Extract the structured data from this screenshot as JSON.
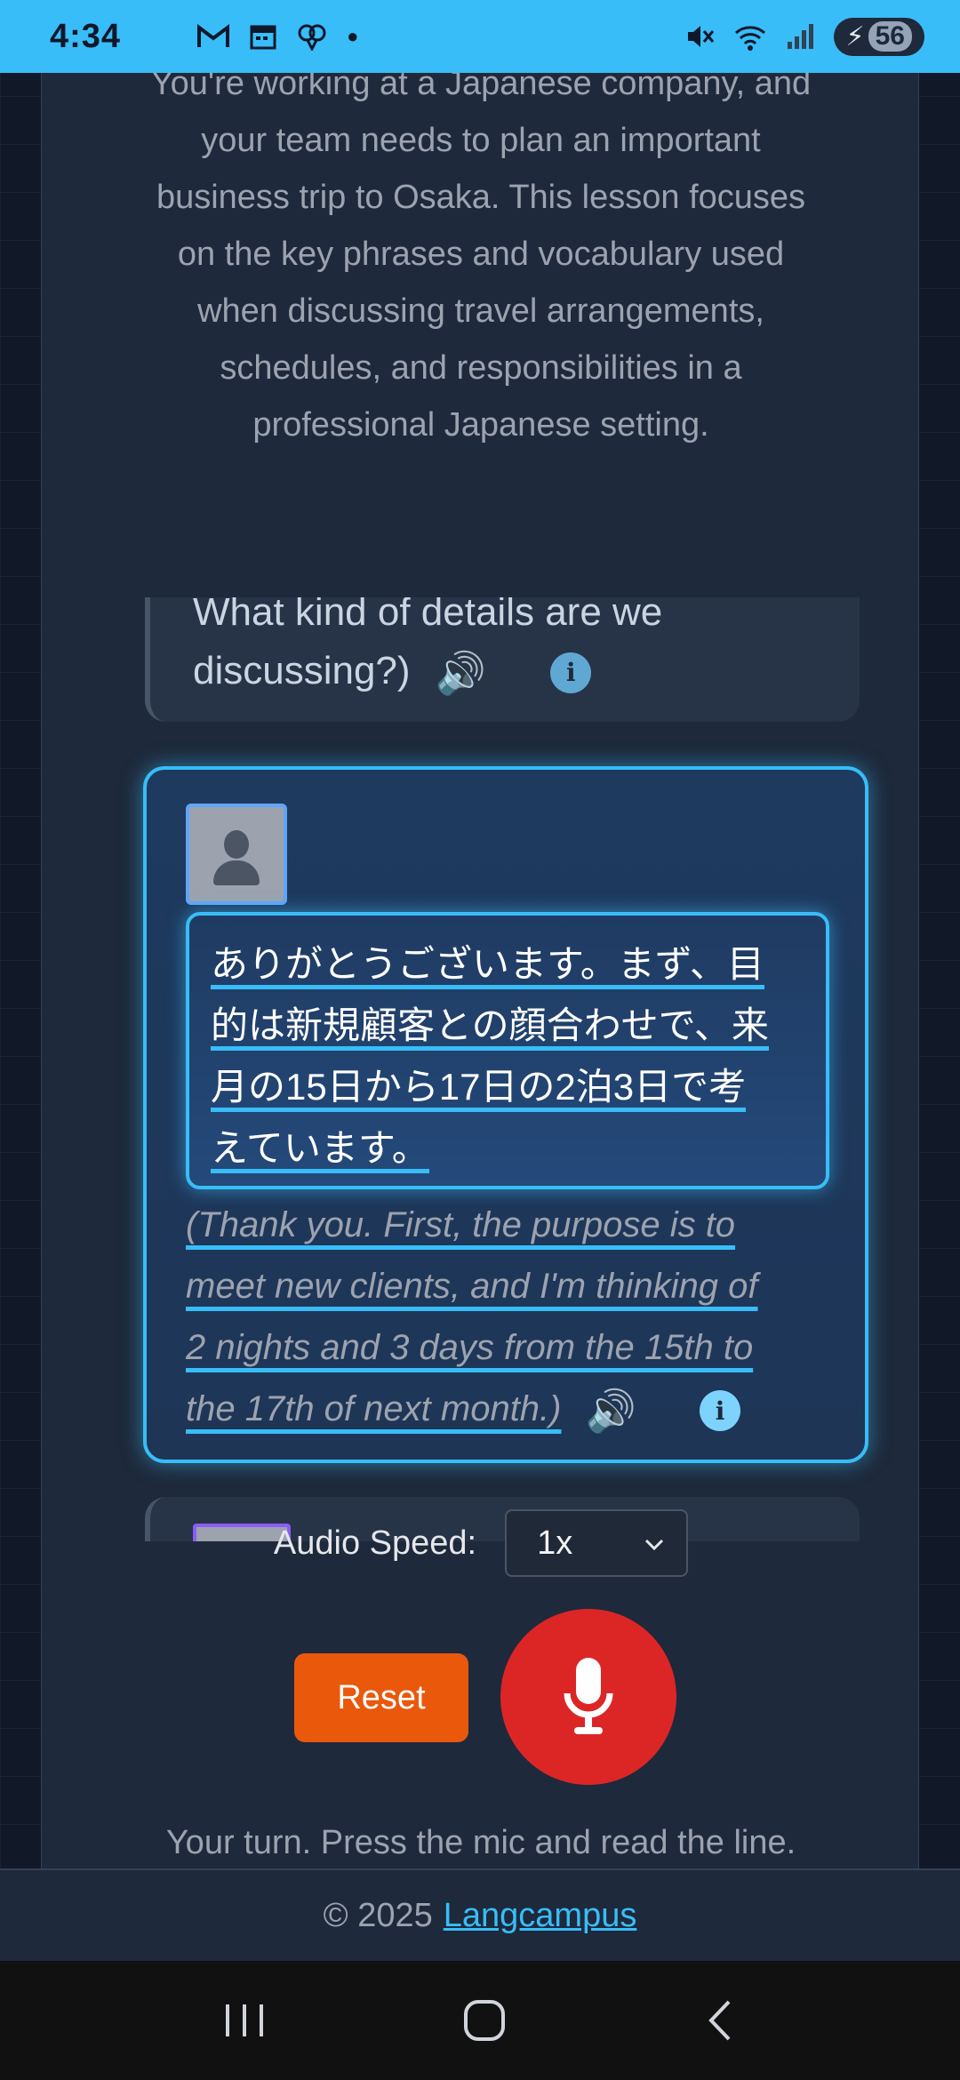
{
  "status_bar": {
    "time": "4:34",
    "notifications": [
      "gmail-icon",
      "calendar-icon",
      "brain-icon",
      "dot-icon"
    ],
    "battery": "56"
  },
  "intro": {
    "lines": [
      "You're working at a Japanese company, and",
      "your team needs to plan an important",
      "business trip to Osaka. This lesson focuses",
      "on the key phrases and vocabulary used",
      "when discussing travel arrangements,",
      "schedules, and responsibilities in a",
      "professional Japanese setting."
    ]
  },
  "chat": {
    "previous": {
      "text_line1": "What kind of details are we",
      "text_line2": "discussing?)"
    },
    "current": {
      "japanese": [
        "ありがとうございます。まず、目",
        "的は新規顧客との顔合わせで、来",
        "月の15日から17日の2泊3日で考",
        "えています。"
      ],
      "english": [
        "(Thank you. First, the purpose is to",
        "meet new clients, and I'm thinking of",
        "2 nights and 3 days from the 15th to",
        "the 17th of next month.)"
      ]
    }
  },
  "controls": {
    "audio_speed_label": "Audio Speed:",
    "audio_speed_value": "1x",
    "reset_label": "Reset",
    "turn_text": "Your turn. Press the mic and read the line."
  },
  "footer": {
    "copyright": "© 2025",
    "link": "Langcampus"
  },
  "colors": {
    "status_bar": "#38bdf8",
    "accent": "#38bdf8",
    "reset": "#ea580c",
    "mic": "#dc2626"
  }
}
